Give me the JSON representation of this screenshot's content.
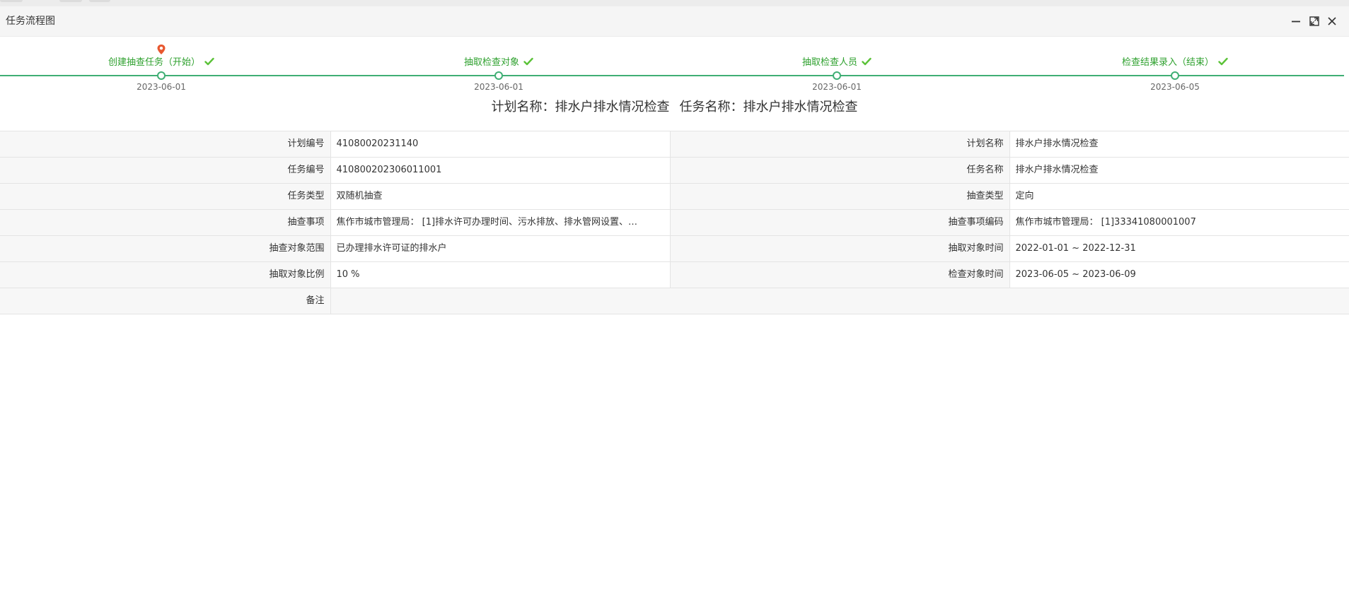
{
  "window": {
    "title": "任务流程图"
  },
  "timeline": {
    "steps": [
      {
        "label": "创建抽查任务（开始）",
        "date": "2023-06-01",
        "current": true
      },
      {
        "label": "抽取检查对象",
        "date": "2023-06-01",
        "current": false
      },
      {
        "label": "抽取检查人员",
        "date": "2023-06-01",
        "current": false
      },
      {
        "label": "检查结果录入（结束）",
        "date": "2023-06-05",
        "current": false
      }
    ]
  },
  "headline": {
    "plan": "计划名称：排水户排水情况检查",
    "task": "任务名称：排水户排水情况检查"
  },
  "info": {
    "rows": [
      {
        "l1": "计划编号",
        "v1": "41080020231140",
        "l2": "计划名称",
        "v2": "排水户排水情况检查"
      },
      {
        "l1": "任务编号",
        "v1": "410800202306011001",
        "l2": "任务名称",
        "v2": "排水户排水情况检查"
      },
      {
        "l1": "任务类型",
        "v1": "双随机抽查",
        "l2": "抽查类型",
        "v2": "定向"
      },
      {
        "l1": "抽查事项",
        "v1": "焦作市城市管理局：  [1]排水许可办理时间、污水排放、排水管网设置、…",
        "l2": "抽查事项编码",
        "v2": "焦作市城市管理局：  [1]33341080001007"
      },
      {
        "l1": "抽查对象范围",
        "v1": "已办理排水许可证的排水户",
        "l2": "抽取对象时间",
        "v2": "2022-01-01 ~ 2022-12-31"
      },
      {
        "l1": "抽取对象比例",
        "v1": "10 %",
        "l2": "检查对象时间",
        "v2": "2023-06-05 ~ 2023-06-09"
      }
    ],
    "remark_label": "备注",
    "remark_value": ""
  },
  "colors": {
    "accent_green": "#3fae74",
    "label_green": "#2fa12f",
    "pin_red": "#e8572f"
  },
  "icons": [
    "minimize-icon",
    "maximize-icon",
    "close-icon",
    "location-pin-icon",
    "check-icon"
  ]
}
